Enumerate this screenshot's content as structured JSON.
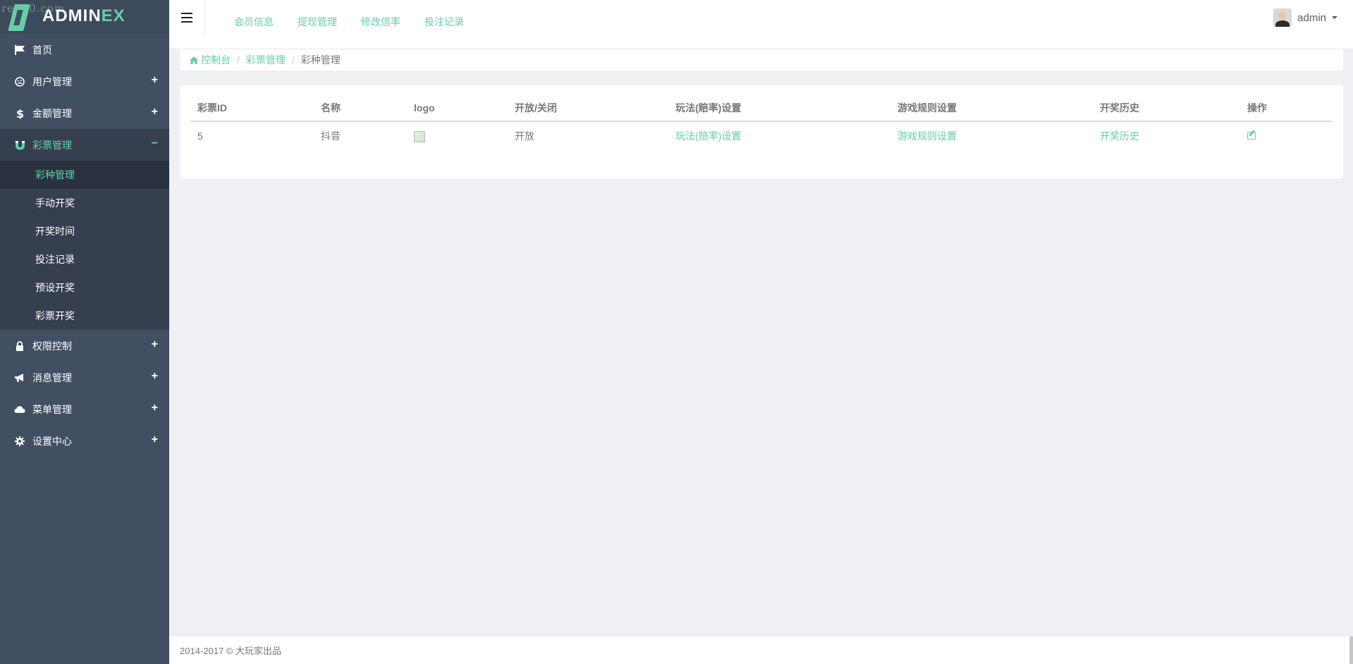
{
  "logo": {
    "watermark": "re520.com",
    "text_main": "ADMIN",
    "text_accent": "EX"
  },
  "colors": {
    "accent": "#65cea7",
    "sidebar_bg": "#424f63",
    "sidebar_active": "#353f4f",
    "page_bg": "#eff0f4"
  },
  "sidebar": {
    "items": [
      {
        "label": "首页",
        "icon": "flag-icon"
      },
      {
        "label": "用户管理",
        "icon": "smile-icon",
        "toggle": "+"
      },
      {
        "label": "金额管理",
        "icon": "dollar-icon",
        "toggle": "+"
      },
      {
        "label": "彩票管理",
        "icon": "magnet-icon",
        "toggle": "−"
      },
      {
        "label": "权限控制",
        "icon": "lock-icon",
        "toggle": "+"
      },
      {
        "label": "消息管理",
        "icon": "bullhorn-icon",
        "toggle": "+"
      },
      {
        "label": "菜单管理",
        "icon": "cloud-icon",
        "toggle": "+"
      },
      {
        "label": "设置中心",
        "icon": "gear-icon",
        "toggle": "+"
      }
    ],
    "submenu": [
      "彩种管理",
      "手动开奖",
      "开奖时间",
      "投注记录",
      "预设开奖",
      "彩票开奖"
    ]
  },
  "header": {
    "links": [
      "会员信息",
      "提现管理",
      "修改倍率",
      "投注记录"
    ],
    "username": "admin"
  },
  "breadcrumb": {
    "home": "控制台",
    "parent": "彩票管理",
    "current": "彩种管理"
  },
  "table": {
    "headers": [
      "彩票ID",
      "名称",
      "logo",
      "开放/关闭",
      "玩法(赔率)设置",
      "游戏规则设置",
      "开奖历史",
      "操作"
    ],
    "rows": [
      {
        "id": "5",
        "name": "抖音",
        "status": "开放",
        "play": "玩法(赔率)设置",
        "rules": "游戏规则设置",
        "history": "开奖历史"
      }
    ]
  },
  "footer": {
    "text": "2014-2017 © 大玩家出品"
  }
}
